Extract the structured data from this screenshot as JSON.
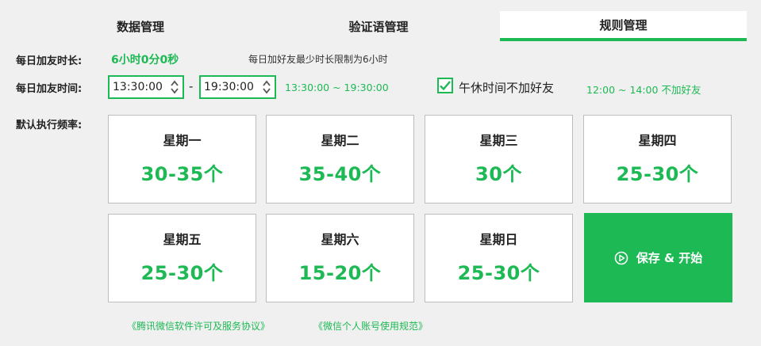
{
  "tabs": [
    {
      "label": "数据管理"
    },
    {
      "label": "验证语管理"
    },
    {
      "label": "规则管理"
    }
  ],
  "daily_duration": {
    "label": "每日加友时长:",
    "value": "6小时0分0秒",
    "note": "每日加好友最少时长限制为6小时"
  },
  "daily_time": {
    "label": "每日加友时间:",
    "start": "13:30:00",
    "separator": "-",
    "end": "19:30:00",
    "range_text": "13:30:00 ~ 19:30:00"
  },
  "lunch_break": {
    "checked": true,
    "label": "午休时间不加好友",
    "range_text": "12:00 ~ 14:00 不加好友"
  },
  "frequency": {
    "label": "默认执行频率:",
    "days": [
      {
        "day": "星期一",
        "count": "30-35个"
      },
      {
        "day": "星期二",
        "count": "35-40个"
      },
      {
        "day": "星期三",
        "count": "30个"
      },
      {
        "day": "星期四",
        "count": "25-30个"
      },
      {
        "day": "星期五",
        "count": "25-30个"
      },
      {
        "day": "星期六",
        "count": "15-20个"
      },
      {
        "day": "星期日",
        "count": "25-30个"
      }
    ]
  },
  "save_button": {
    "label": "保存 & 开始",
    "icon": "play-circle-icon"
  },
  "links": [
    {
      "text": "《腾讯微信软件许可及服务协议》"
    },
    {
      "text": "《微信个人账号使用规范》"
    }
  ],
  "colors": {
    "accent": "#1db954",
    "background": "#f0f0f0"
  }
}
